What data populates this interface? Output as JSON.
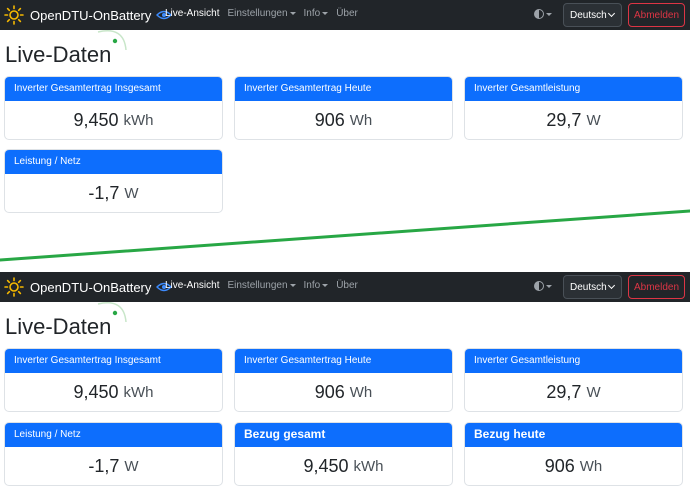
{
  "navbar": {
    "brand": "OpenDTU-OnBattery",
    "nav_items": [
      {
        "label": "Live-Ansicht",
        "active": true,
        "dropdown": false
      },
      {
        "label": "Einstellungen",
        "active": false,
        "dropdown": true
      },
      {
        "label": "Info",
        "active": false,
        "dropdown": true
      },
      {
        "label": "Über",
        "active": false,
        "dropdown": false
      }
    ],
    "language": "Deutsch",
    "logout_label": "Abmelden"
  },
  "page": {
    "title": "Live-Daten"
  },
  "cards": {
    "total_yield": {
      "title": "Inverter Gesamtertrag Insgesamt",
      "value": "9,450",
      "unit": "kWh"
    },
    "today_yield": {
      "title": "Inverter Gesamtertrag Heute",
      "value": "906",
      "unit": "Wh"
    },
    "total_power": {
      "title": "Inverter Gesamtleistung",
      "value": "29,7",
      "unit": "W"
    },
    "grid_power": {
      "title": "Leistung / Netz",
      "value": "-1,7",
      "unit": "W"
    },
    "import_total": {
      "title": "Bezug gesamt",
      "value": "9,450",
      "unit": "kWh"
    },
    "import_today": {
      "title": "Bezug heute",
      "value": "906",
      "unit": "Wh"
    }
  },
  "colors": {
    "navbar_bg": "#212529",
    "card_header_bg": "#0d6efd",
    "logout_red": "#dc3545",
    "brand_sun": "#f5b800",
    "annotation_green": "#28a745"
  },
  "icons": [
    "sun-icon",
    "eye-icon",
    "theme-toggle-icon",
    "chevron-down-icon"
  ]
}
